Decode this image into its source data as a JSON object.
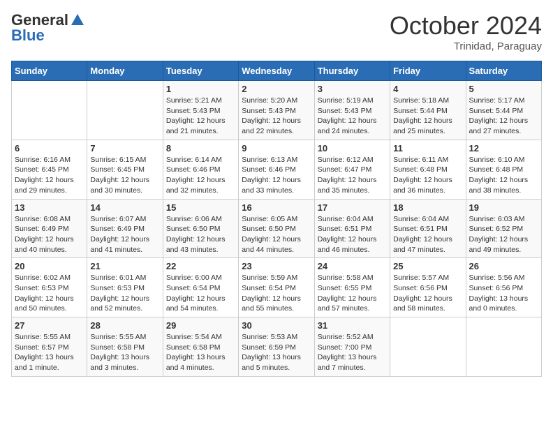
{
  "logo": {
    "general": "General",
    "blue": "Blue"
  },
  "title": "October 2024",
  "subtitle": "Trinidad, Paraguay",
  "weekdays": [
    "Sunday",
    "Monday",
    "Tuesday",
    "Wednesday",
    "Thursday",
    "Friday",
    "Saturday"
  ],
  "weeks": [
    [
      {
        "day": "",
        "info": ""
      },
      {
        "day": "",
        "info": ""
      },
      {
        "day": "1",
        "info": "Sunrise: 5:21 AM\nSunset: 5:43 PM\nDaylight: 12 hours\nand 21 minutes."
      },
      {
        "day": "2",
        "info": "Sunrise: 5:20 AM\nSunset: 5:43 PM\nDaylight: 12 hours\nand 22 minutes."
      },
      {
        "day": "3",
        "info": "Sunrise: 5:19 AM\nSunset: 5:43 PM\nDaylight: 12 hours\nand 24 minutes."
      },
      {
        "day": "4",
        "info": "Sunrise: 5:18 AM\nSunset: 5:44 PM\nDaylight: 12 hours\nand 25 minutes."
      },
      {
        "day": "5",
        "info": "Sunrise: 5:17 AM\nSunset: 5:44 PM\nDaylight: 12 hours\nand 27 minutes."
      }
    ],
    [
      {
        "day": "6",
        "info": "Sunrise: 6:16 AM\nSunset: 6:45 PM\nDaylight: 12 hours\nand 29 minutes."
      },
      {
        "day": "7",
        "info": "Sunrise: 6:15 AM\nSunset: 6:45 PM\nDaylight: 12 hours\nand 30 minutes."
      },
      {
        "day": "8",
        "info": "Sunrise: 6:14 AM\nSunset: 6:46 PM\nDaylight: 12 hours\nand 32 minutes."
      },
      {
        "day": "9",
        "info": "Sunrise: 6:13 AM\nSunset: 6:46 PM\nDaylight: 12 hours\nand 33 minutes."
      },
      {
        "day": "10",
        "info": "Sunrise: 6:12 AM\nSunset: 6:47 PM\nDaylight: 12 hours\nand 35 minutes."
      },
      {
        "day": "11",
        "info": "Sunrise: 6:11 AM\nSunset: 6:48 PM\nDaylight: 12 hours\nand 36 minutes."
      },
      {
        "day": "12",
        "info": "Sunrise: 6:10 AM\nSunset: 6:48 PM\nDaylight: 12 hours\nand 38 minutes."
      }
    ],
    [
      {
        "day": "13",
        "info": "Sunrise: 6:08 AM\nSunset: 6:49 PM\nDaylight: 12 hours\nand 40 minutes."
      },
      {
        "day": "14",
        "info": "Sunrise: 6:07 AM\nSunset: 6:49 PM\nDaylight: 12 hours\nand 41 minutes."
      },
      {
        "day": "15",
        "info": "Sunrise: 6:06 AM\nSunset: 6:50 PM\nDaylight: 12 hours\nand 43 minutes."
      },
      {
        "day": "16",
        "info": "Sunrise: 6:05 AM\nSunset: 6:50 PM\nDaylight: 12 hours\nand 44 minutes."
      },
      {
        "day": "17",
        "info": "Sunrise: 6:04 AM\nSunset: 6:51 PM\nDaylight: 12 hours\nand 46 minutes."
      },
      {
        "day": "18",
        "info": "Sunrise: 6:04 AM\nSunset: 6:51 PM\nDaylight: 12 hours\nand 47 minutes."
      },
      {
        "day": "19",
        "info": "Sunrise: 6:03 AM\nSunset: 6:52 PM\nDaylight: 12 hours\nand 49 minutes."
      }
    ],
    [
      {
        "day": "20",
        "info": "Sunrise: 6:02 AM\nSunset: 6:53 PM\nDaylight: 12 hours\nand 50 minutes."
      },
      {
        "day": "21",
        "info": "Sunrise: 6:01 AM\nSunset: 6:53 PM\nDaylight: 12 hours\nand 52 minutes."
      },
      {
        "day": "22",
        "info": "Sunrise: 6:00 AM\nSunset: 6:54 PM\nDaylight: 12 hours\nand 54 minutes."
      },
      {
        "day": "23",
        "info": "Sunrise: 5:59 AM\nSunset: 6:54 PM\nDaylight: 12 hours\nand 55 minutes."
      },
      {
        "day": "24",
        "info": "Sunrise: 5:58 AM\nSunset: 6:55 PM\nDaylight: 12 hours\nand 57 minutes."
      },
      {
        "day": "25",
        "info": "Sunrise: 5:57 AM\nSunset: 6:56 PM\nDaylight: 12 hours\nand 58 minutes."
      },
      {
        "day": "26",
        "info": "Sunrise: 5:56 AM\nSunset: 6:56 PM\nDaylight: 13 hours\nand 0 minutes."
      }
    ],
    [
      {
        "day": "27",
        "info": "Sunrise: 5:55 AM\nSunset: 6:57 PM\nDaylight: 13 hours\nand 1 minute."
      },
      {
        "day": "28",
        "info": "Sunrise: 5:55 AM\nSunset: 6:58 PM\nDaylight: 13 hours\nand 3 minutes."
      },
      {
        "day": "29",
        "info": "Sunrise: 5:54 AM\nSunset: 6:58 PM\nDaylight: 13 hours\nand 4 minutes."
      },
      {
        "day": "30",
        "info": "Sunrise: 5:53 AM\nSunset: 6:59 PM\nDaylight: 13 hours\nand 5 minutes."
      },
      {
        "day": "31",
        "info": "Sunrise: 5:52 AM\nSunset: 7:00 PM\nDaylight: 13 hours\nand 7 minutes."
      },
      {
        "day": "",
        "info": ""
      },
      {
        "day": "",
        "info": ""
      }
    ]
  ]
}
